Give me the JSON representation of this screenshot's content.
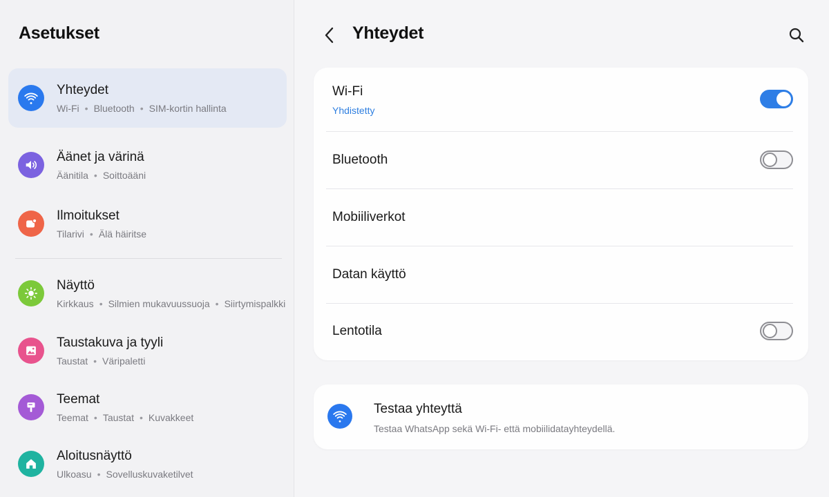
{
  "app_title": "Asetukset",
  "sidebar": {
    "items": [
      {
        "title": "Yhteydet",
        "sub": [
          "Wi-Fi",
          "Bluetooth",
          "SIM-kortin hallinta"
        ],
        "icon": "wifi-icon",
        "color": "#2a79ee",
        "active": true
      },
      {
        "title": "Äänet ja värinä",
        "sub": [
          "Äänitila",
          "Soittoääni"
        ],
        "icon": "speaker-icon",
        "color": "#7b62e0",
        "active": false
      },
      {
        "title": "Ilmoitukset",
        "sub": [
          "Tilarivi",
          "Älä häiritse"
        ],
        "icon": "notification-icon",
        "color": "#ef6548",
        "active": false
      },
      {
        "title": "Näyttö",
        "sub": [
          "Kirkkaus",
          "Silmien mukavuussuoja",
          "Siirtymispalkki"
        ],
        "icon": "sun-icon",
        "color": "#7cc93a",
        "active": false
      },
      {
        "title": "Taustakuva ja tyyli",
        "sub": [
          "Taustat",
          "Väripaletti"
        ],
        "icon": "image-icon",
        "color": "#e8538d",
        "active": false
      },
      {
        "title": "Teemat",
        "sub": [
          "Teemat",
          "Taustat",
          "Kuvakkeet"
        ],
        "icon": "brush-icon",
        "color": "#a45ad6",
        "active": false
      },
      {
        "title": "Aloitusnäyttö",
        "sub": [
          "Ulkoasu",
          "Sovelluskuvaketilvet"
        ],
        "icon": "home-icon",
        "color": "#1fb3a0",
        "active": false
      }
    ]
  },
  "header": {
    "title": "Yhteydet",
    "back_icon": "back-arrow-icon",
    "search_icon": "search-icon"
  },
  "connections": {
    "wifi": {
      "label": "Wi-Fi",
      "status": "Yhdistetty",
      "enabled": true
    },
    "bluetooth": {
      "label": "Bluetooth",
      "enabled": false
    },
    "mobile": {
      "label": "Mobiiliverkot"
    },
    "data": {
      "label": "Datan käyttö"
    },
    "airplane": {
      "label": "Lentotila",
      "enabled": false
    }
  },
  "test_card": {
    "title": "Testaa yhteyttä",
    "description": "Testaa WhatsApp sekä Wi-Fi- että mobiilidatayhteydellä.",
    "icon": "wifi-icon"
  },
  "colors": {
    "accent": "#2e7ee6",
    "active_item_bg": "#e4e9f4"
  }
}
